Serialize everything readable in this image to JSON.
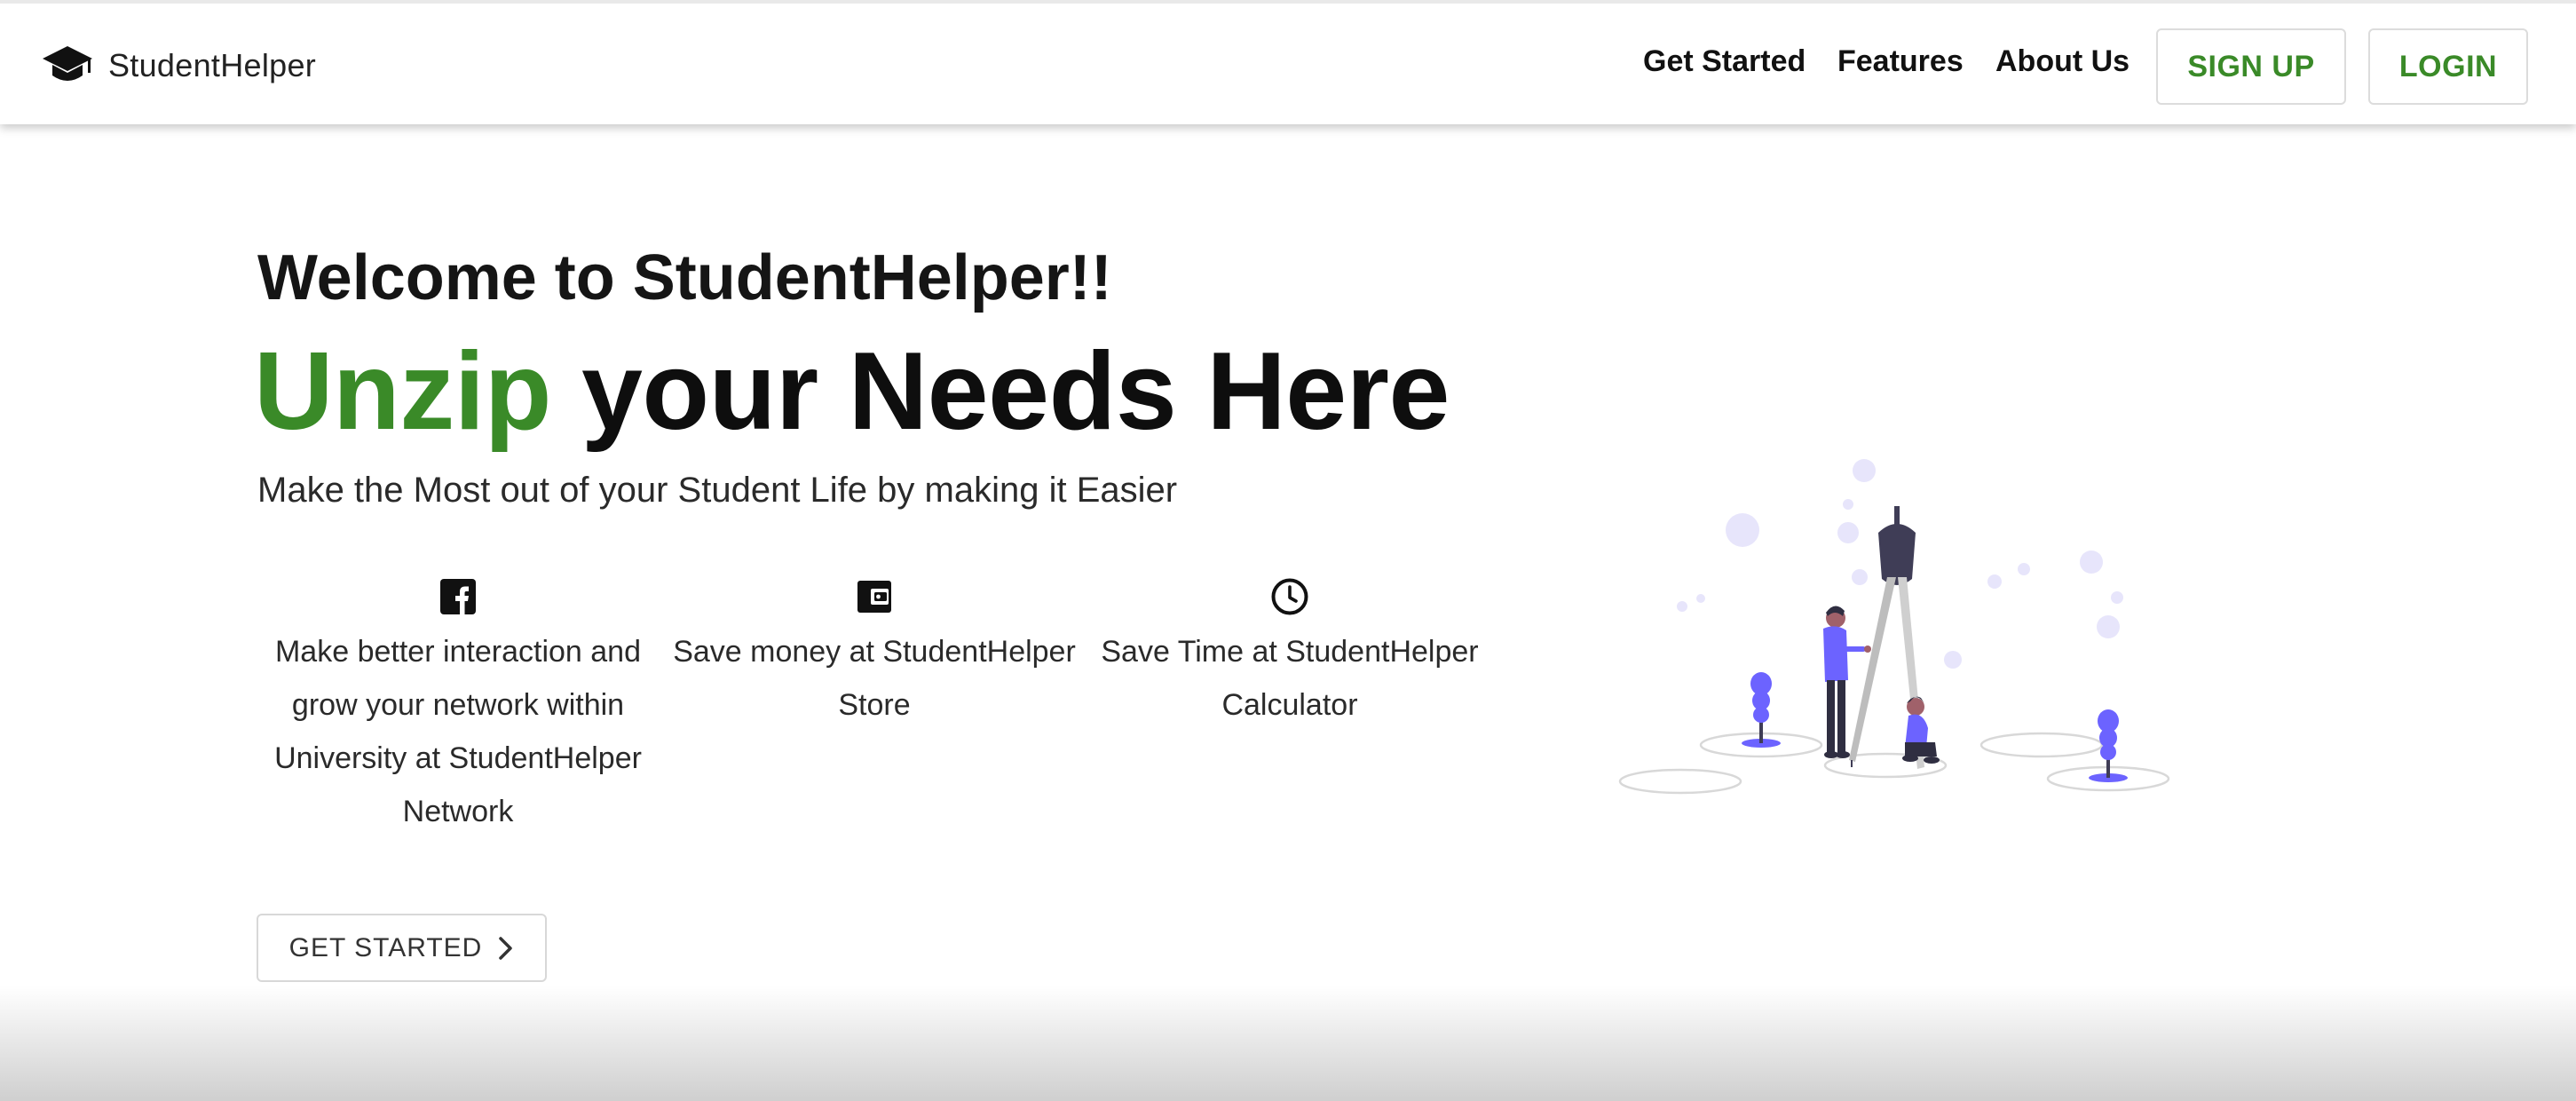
{
  "header": {
    "brand": "StudentHelper",
    "nav": [
      "Get Started",
      "Features",
      "About Us"
    ],
    "signup_label": "SIGN UP",
    "login_label": "LOGIN"
  },
  "hero": {
    "welcome": "Welcome to StudentHelper!!",
    "headline_accent": "Unzip",
    "headline_rest": " your Needs Here",
    "subline": "Make the Most out of your Student Life by making it Easier",
    "features": [
      {
        "icon": "facebook-icon",
        "text": "Make better interaction and grow your network within University at StudentHelper Network"
      },
      {
        "icon": "wallet-icon",
        "text": "Save money at StudentHelper Store"
      },
      {
        "icon": "clock-icon",
        "text": "Save Time at StudentHelper Calculator"
      }
    ],
    "cta_label": "GET STARTED"
  },
  "colors": {
    "accent": "#3a8a28",
    "illustration_purple": "#6c63ff",
    "illustration_dark": "#3f3d56"
  }
}
